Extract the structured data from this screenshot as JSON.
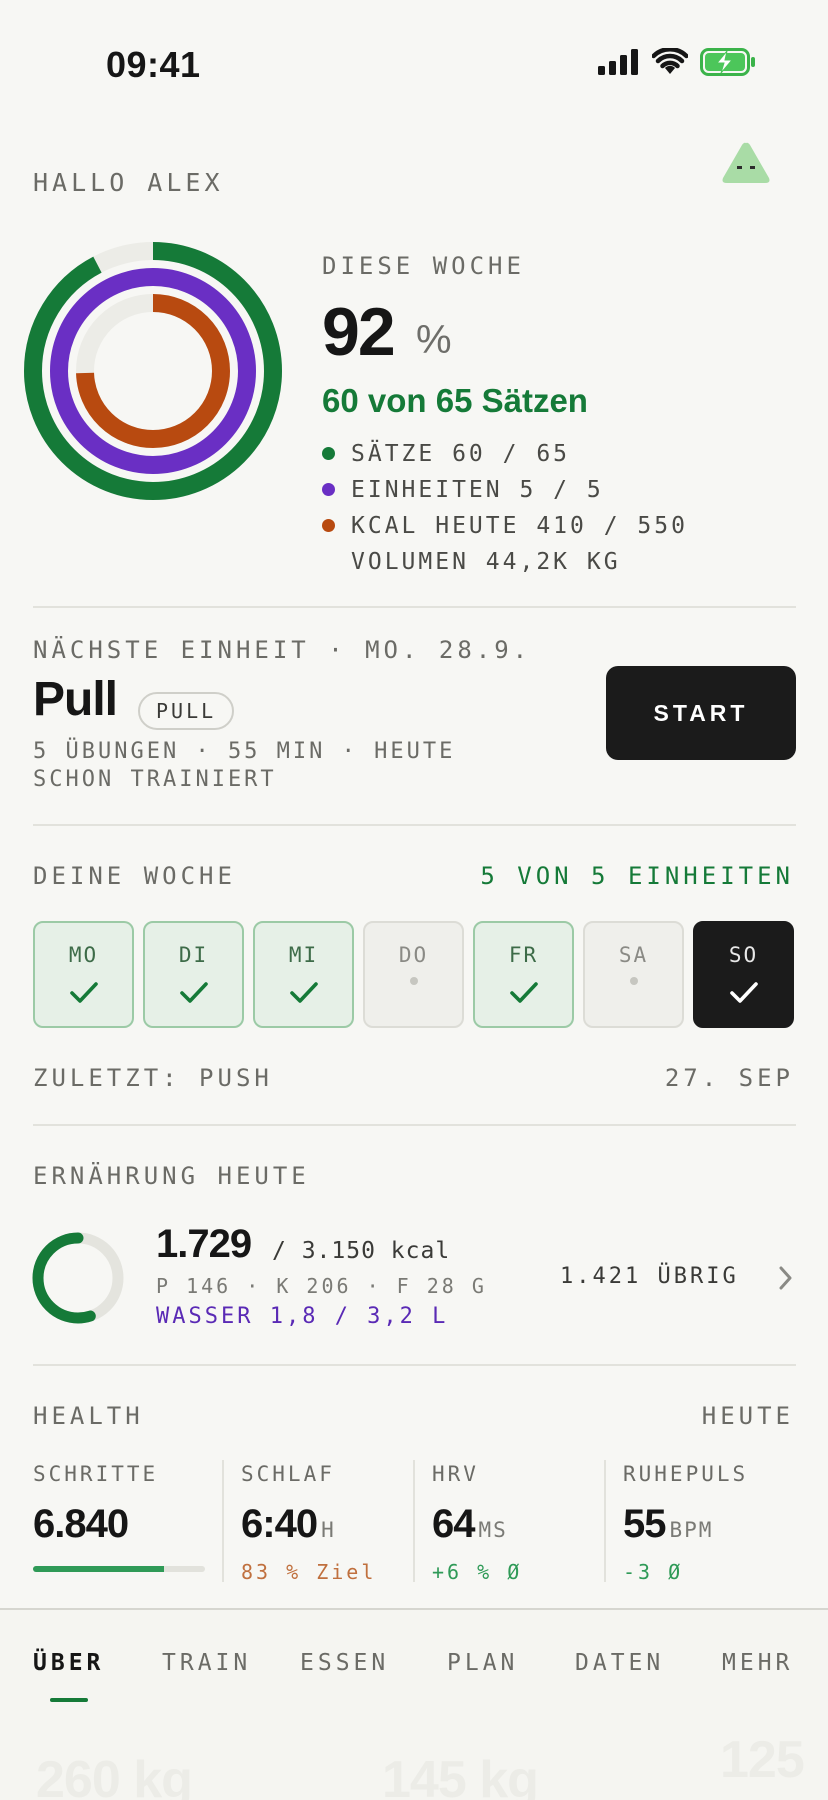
{
  "status": {
    "time": "09:41"
  },
  "greeting": "HALLO ALEX",
  "week_summary": {
    "label": "DIESE WOCHE",
    "percent": "92",
    "percent_unit": "%",
    "sets_text": "60 von 65 Sätzen",
    "legend": [
      {
        "text": "SÄTZE 60 / 65",
        "color": "#157a38"
      },
      {
        "text": "EINHEITEN 5 / 5",
        "color": "#6a2fc4"
      },
      {
        "text": "KCAL HEUTE 410 / 550",
        "color": "#b84a10"
      },
      {
        "text": "VOLUMEN 44,2K KG"
      }
    ],
    "rings": [
      {
        "name": "saetze",
        "fraction": 0.923,
        "color": "#157a38"
      },
      {
        "name": "einheiten",
        "fraction": 1.0,
        "color": "#6a2fc4"
      },
      {
        "name": "kcal",
        "fraction": 0.745,
        "color": "#b84a10"
      }
    ]
  },
  "next_session": {
    "label": "NÄCHSTE EINHEIT · MO. 28.9.",
    "title": "Pull",
    "tag": "PULL",
    "meta": "5 ÜBUNGEN · 55 MIN · HEUTE SCHON TRAINIERT",
    "start_label": "START"
  },
  "your_week": {
    "label": "DEINE WOCHE",
    "count": "5 VON 5 EINHEITEN",
    "days": [
      {
        "label": "MO",
        "state": "done"
      },
      {
        "label": "DI",
        "state": "done"
      },
      {
        "label": "MI",
        "state": "done"
      },
      {
        "label": "DO",
        "state": "rest"
      },
      {
        "label": "FR",
        "state": "done"
      },
      {
        "label": "SA",
        "state": "rest"
      },
      {
        "label": "SO",
        "state": "today"
      }
    ],
    "last_label": "ZULETZT: PUSH",
    "last_date": "27. SEP"
  },
  "nutrition": {
    "label": "ERNÄHRUNG HEUTE",
    "kcal": "1.729",
    "kcal_of": "/ 3.150 kcal",
    "macros": "P 146 · K 206 · F 28 G",
    "water": "WASSER 1,8 / 3,2 L",
    "remaining": "1.421 ÜBRIG",
    "ring_fraction": 0.549
  },
  "health": {
    "label": "HEALTH",
    "period": "HEUTE",
    "metrics": [
      {
        "label": "SCHRITTE",
        "value": "6.840",
        "unit": "",
        "sub": "",
        "progress": 0.76
      },
      {
        "label": "SCHLAF",
        "value": "6:40",
        "unit": "H",
        "sub": "83 % Ziel",
        "sub_color": "#c0703e"
      },
      {
        "label": "HRV",
        "value": "64",
        "unit": "MS",
        "sub": "+6 % Ø",
        "sub_color": "#2f9a57"
      },
      {
        "label": "RUHEPULS",
        "value": "55",
        "unit": "BPM",
        "sub": "-3 Ø",
        "sub_color": "#2f9a57"
      }
    ]
  },
  "tabs": [
    {
      "label": "ÜBER",
      "active": true
    },
    {
      "label": "TRAIN"
    },
    {
      "label": "ESSEN"
    },
    {
      "label": "PLAN"
    },
    {
      "label": "DATEN"
    },
    {
      "label": "MEHR"
    }
  ],
  "background_ghosts": [
    "260 kg",
    "145 kg",
    "125"
  ]
}
